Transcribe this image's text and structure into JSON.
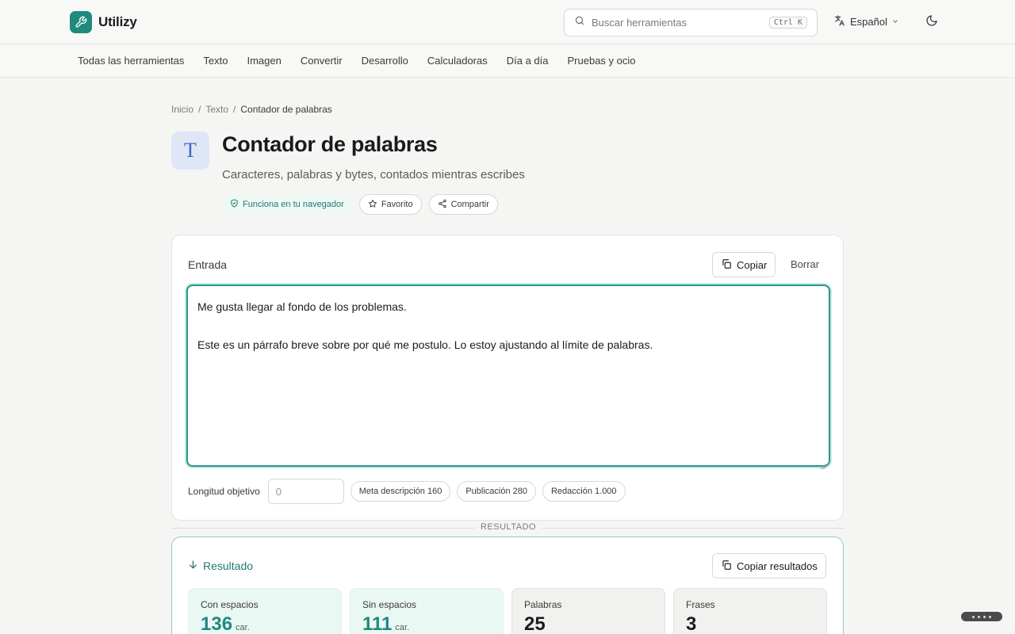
{
  "brand": {
    "name": "Utilizy",
    "logo_icon": "wrench-icon",
    "accent": "#1f8a7e"
  },
  "search": {
    "placeholder": "Buscar herramientas",
    "shortcut": "Ctrl K"
  },
  "language": {
    "label": "Español"
  },
  "nav": {
    "items": [
      "Todas las herramientas",
      "Texto",
      "Imagen",
      "Convertir",
      "Desarrollo",
      "Calculadoras",
      "Día a día",
      "Pruebas y ocio"
    ]
  },
  "breadcrumb": {
    "home": "Inicio",
    "section": "Texto",
    "current": "Contador de palabras",
    "separator": "/"
  },
  "tool": {
    "icon_letter": "T",
    "title": "Contador de palabras",
    "subtitle": "Caracteres, palabras y bytes, contados mientras escribes",
    "badge": "Funciona en tu navegador",
    "favorite_label": "Favorito",
    "share_label": "Compartir"
  },
  "input": {
    "label": "Entrada",
    "copy_label": "Copiar",
    "clear_label": "Borrar",
    "line1": "Me gusta llegar al fondo de los problemas.",
    "line2": "Este es un párrafo breve sobre por qué me postulo. Lo estoy ajustando al límite de palabras.",
    "target_label": "Longitud objetivo",
    "target_placeholder": "0",
    "presets": [
      "Meta descripción 160",
      "Publicación 280",
      "Redacción 1.000"
    ]
  },
  "divider": {
    "label": "RESULTADO"
  },
  "result": {
    "title": "Resultado",
    "copy_label": "Copiar resultados",
    "stats": [
      {
        "label": "Con espacios",
        "value": "136",
        "unit": "car."
      },
      {
        "label": "Sin espacios",
        "value": "111",
        "unit": "car."
      },
      {
        "label": "Palabras",
        "value": "25",
        "unit": ""
      },
      {
        "label": "Frases",
        "value": "3",
        "unit": ""
      }
    ]
  }
}
